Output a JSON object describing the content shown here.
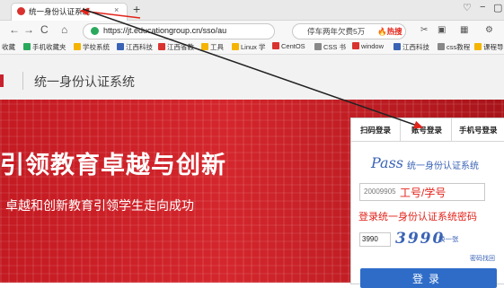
{
  "browser": {
    "tab": {
      "title": "统一身份认证系统",
      "close": "×"
    },
    "new_tab": "+",
    "window_controls": [
      "♡",
      "−",
      "▢"
    ],
    "nav": {
      "back": "←",
      "forward": "→",
      "reload": "C",
      "home": "⌂"
    },
    "address": "https://jt.educationgroup.cn/sso/au",
    "search": {
      "text": "停车两年欠费5万",
      "hot": "🔥热搜"
    },
    "toolbar_icons": [
      "✂",
      "▣",
      "▦",
      "⚙"
    ],
    "bookmarks": [
      {
        "label": "收藏",
        "color": "#f4b400"
      },
      {
        "label": "手机收藏夹",
        "color": "#2aa95d"
      },
      {
        "label": "学校系统",
        "color": "#f4b400"
      },
      {
        "label": "江西科技",
        "color": "#3a63b5"
      },
      {
        "label": "江西省教",
        "color": "#d9332f"
      },
      {
        "label": "工具",
        "color": "#f4b400"
      },
      {
        "label": "Linux 学",
        "color": "#f4b400"
      },
      {
        "label": "CentOS",
        "color": "#d9332f"
      },
      {
        "label": "CSS 书",
        "color": "#888888"
      },
      {
        "label": "window",
        "color": "#d9332f"
      },
      {
        "label": "江西科技",
        "color": "#3a63b5"
      },
      {
        "label": "css教程",
        "color": "#888888"
      },
      {
        "label": "课程导",
        "color": "#f4b400"
      }
    ]
  },
  "site": {
    "title": "统一身份认证系统",
    "banner_slogan": "引领教育卓越与创新",
    "banner_sub": "卓越和创新教育引领学生走向成功"
  },
  "login": {
    "tabs": [
      "扫码登录",
      "账号登录",
      "手机号登录"
    ],
    "active_tab": "账号登录",
    "pass_logo": "Pass",
    "pass_sub": "统一身份认证系统",
    "username_value": "20009905",
    "username_hint": "工号/学号",
    "password_note": "登录统一身份认证系统密码",
    "captcha_input": "3990",
    "captcha_image": "3990",
    "refresh": "换一张",
    "forgot": "密码找回",
    "login_button": "登录"
  },
  "colors": {
    "accent_red": "#e2231a",
    "banner_red": "#c41a22",
    "brand_blue": "#3a63b5",
    "button_blue": "#2e6cc8"
  }
}
